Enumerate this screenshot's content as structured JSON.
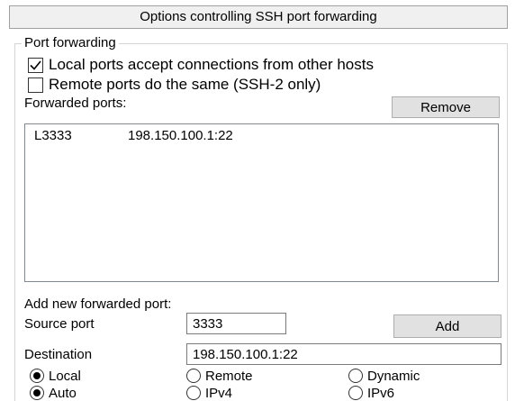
{
  "header": {
    "title": "Options controlling SSH port forwarding"
  },
  "port_forwarding": {
    "group_label": "Port forwarding",
    "local_accept": {
      "label": "Local ports accept connections from other hosts",
      "checked": true
    },
    "remote_same": {
      "label": "Remote ports do the same (SSH-2 only)",
      "checked": false
    },
    "forwarded_label": "Forwarded ports:",
    "remove_label": "Remove",
    "forwarded_list": [
      {
        "source": "L3333",
        "destination": "198.150.100.1:22"
      }
    ]
  },
  "add_new": {
    "heading": "Add new forwarded port:",
    "source_label": "Source port",
    "source_value": "3333",
    "add_label": "Add",
    "destination_label": "Destination",
    "destination_value": "198.150.100.1:22"
  },
  "direction": {
    "options": [
      "Local",
      "Remote",
      "Dynamic"
    ],
    "selected": "Local"
  },
  "ip_version": {
    "options": [
      "Auto",
      "IPv4",
      "IPv6"
    ],
    "selected": "Auto"
  }
}
